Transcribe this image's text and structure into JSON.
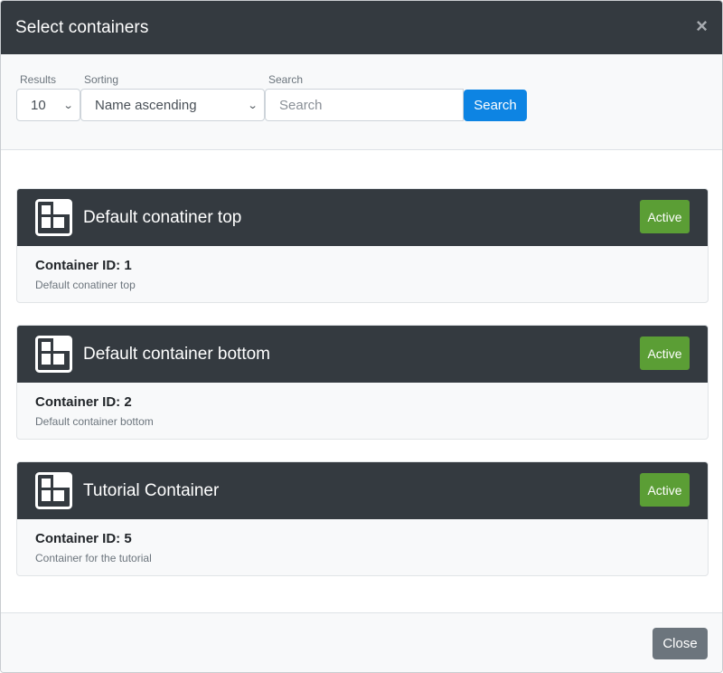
{
  "modal": {
    "title": "Select containers",
    "close_glyph": "×",
    "footer_close_label": "Close"
  },
  "filters": {
    "results_label": "Results",
    "results_value": "10",
    "sorting_label": "Sorting",
    "sorting_value": "Name ascending",
    "search_label": "Search",
    "search_placeholder": "Search",
    "search_button": "Search"
  },
  "containers": [
    {
      "title": "Default conatiner top",
      "status": "Active",
      "id_text": "Container ID: 1",
      "description": "Default conatiner top"
    },
    {
      "title": "Default container bottom",
      "status": "Active",
      "id_text": "Container ID: 2",
      "description": "Default container bottom"
    },
    {
      "title": "Tutorial Container",
      "status": "Active",
      "id_text": "Container ID: 5",
      "description": "Container for the tutorial"
    }
  ],
  "icons": {
    "container": "container-grid-icon",
    "chevron": "chevron-down-icon",
    "close": "close-icon"
  },
  "colors": {
    "header": "#343a40",
    "primary": "#0d84e3",
    "success": "#5b9e35",
    "secondary": "#6c757d"
  }
}
